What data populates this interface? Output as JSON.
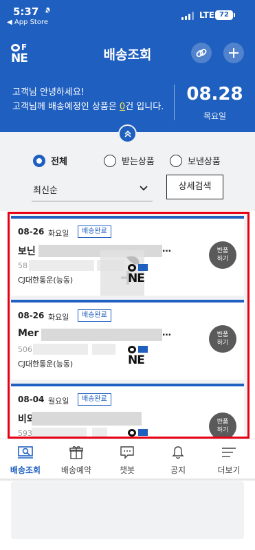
{
  "status_bar": {
    "time": "5:37",
    "back_app": "◀ App Store",
    "network": "LTE",
    "battery": "72"
  },
  "header": {
    "title": "배송조회",
    "logo_top": "F",
    "logo_bottom": "NE"
  },
  "greeting": {
    "hello": "고객님 안녕하세요!",
    "message_prefix": "고객님께 배송예정인 상품은 ",
    "count": "0",
    "message_suffix": "건 입니다.",
    "date": "08.28",
    "weekday": "목요일"
  },
  "filters": {
    "options": [
      {
        "label": "전체",
        "selected": true
      },
      {
        "label": "받는상품",
        "selected": false
      },
      {
        "label": "보낸상품",
        "selected": false
      }
    ],
    "sort_value": "최신순",
    "detail_search_label": "상세검색"
  },
  "deliveries": [
    {
      "date": "08-26",
      "weekday": "화요일",
      "status": "배송완료",
      "name_prefix": "보닌",
      "tracking_prefix": "58",
      "carrier": "CJ대한통운(능동)",
      "return_label": [
        "반품",
        "하기"
      ]
    },
    {
      "date": "08-26",
      "weekday": "화요일",
      "status": "배송완료",
      "name_prefix": "Mer",
      "tracking_prefix": "506",
      "carrier": "CJ대한통운(능동)",
      "return_label": [
        "반품",
        "하기"
      ]
    },
    {
      "date": "08-04",
      "weekday": "월요일",
      "status": "배송완료",
      "name_prefix": "비외",
      "tracking_prefix": "593",
      "carrier": "",
      "return_label": [
        "반품",
        "하기"
      ]
    }
  ],
  "ellipsis": "…",
  "tabs": [
    {
      "label": "배송조회",
      "active": true
    },
    {
      "label": "배송예약",
      "active": false
    },
    {
      "label": "챗봇",
      "active": false
    },
    {
      "label": "공지",
      "active": false
    },
    {
      "label": "더보기",
      "active": false
    }
  ],
  "colors": {
    "primary": "#1f5fbf",
    "highlight_box": "#e60012",
    "count_highlight": "#ffe44d",
    "background": "#f1f2f4"
  },
  "icons": [
    "link-icon",
    "plus-icon",
    "chevron-up-icon",
    "chevron-down-icon",
    "bell-muted-icon",
    "search-box-icon",
    "gift-icon",
    "chat-icon",
    "bell-icon",
    "menu-icon"
  ]
}
